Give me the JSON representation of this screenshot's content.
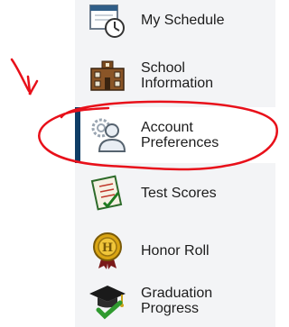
{
  "sidebar": {
    "items": [
      {
        "label": "My Schedule",
        "icon": "calendar-clock-icon"
      },
      {
        "label": "School\nInformation",
        "icon": "school-building-icon"
      },
      {
        "label": "Account\nPreferences",
        "icon": "user-gear-icon",
        "active": true
      },
      {
        "label": "Test Scores",
        "icon": "test-paper-icon"
      },
      {
        "label": "Honor Roll",
        "icon": "honor-medal-icon"
      },
      {
        "label": "Graduation\nProgress",
        "icon": "graduation-cap-check-icon"
      }
    ]
  },
  "annotation": {
    "color": "#e8101a",
    "marks": [
      "red-arrow",
      "red-circle"
    ]
  },
  "colors": {
    "active_bar": "#0e3d66",
    "panel_bg": "#f3f4f6"
  }
}
